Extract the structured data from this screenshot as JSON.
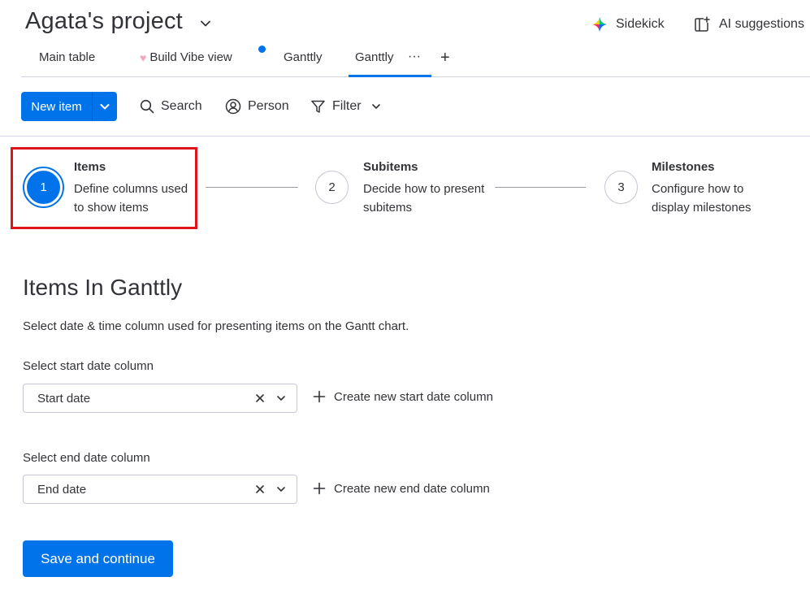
{
  "header": {
    "project_title": "Agata's project",
    "sidekick_label": "Sidekick",
    "ai_suggestions_label": "AI suggestions"
  },
  "tabs": [
    {
      "label": "Main table"
    },
    {
      "label": "Build Vibe view"
    },
    {
      "label": "Ganttly"
    },
    {
      "label": "Ganttly",
      "active": true
    }
  ],
  "tabs_more": "···",
  "tabs_add": "+",
  "toolbar": {
    "new_item_label": "New item",
    "search_label": "Search",
    "person_label": "Person",
    "filter_label": "Filter"
  },
  "steps": [
    {
      "number": "1",
      "title": "Items",
      "description": "Define columns used to show items",
      "active": true
    },
    {
      "number": "2",
      "title": "Subitems",
      "description": "Decide how to present subitems"
    },
    {
      "number": "3",
      "title": "Milestones",
      "description": "Configure how to display milestones"
    }
  ],
  "content": {
    "title": "Items In Ganttly",
    "subtitle": "Select date & time column used for presenting items on the Gantt chart.",
    "start_label": "Select start date column",
    "start_value": "Start date",
    "create_start": "Create new start date column",
    "end_label": "Select end date column",
    "end_value": "End date",
    "create_end": "Create new end date column",
    "save_label": "Save and continue"
  },
  "colors": {
    "primary": "#0073ea",
    "highlight": "#e0141b",
    "text": "#323338",
    "border": "#c3c6d4"
  }
}
